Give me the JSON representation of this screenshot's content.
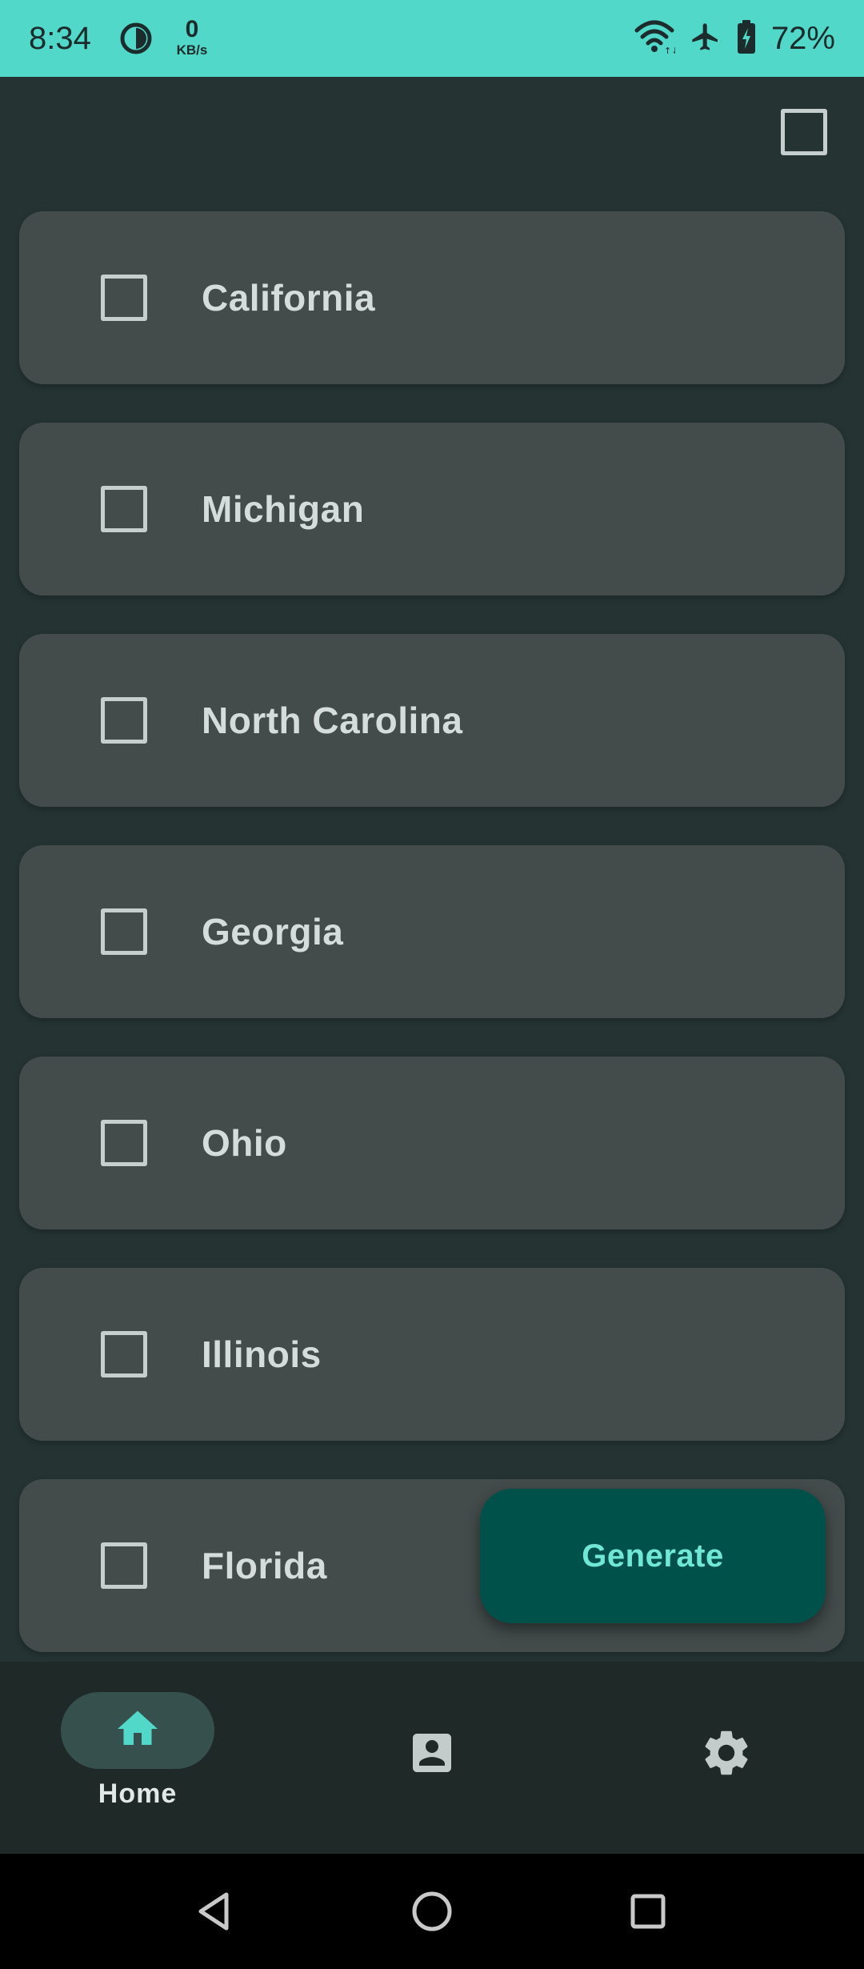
{
  "status_bar": {
    "time": "8:34",
    "net_speed_value": "0",
    "net_speed_unit": "KB/s",
    "battery_percent": "72%",
    "icons": [
      "data-saver-icon",
      "wifi-icon",
      "airplane-icon",
      "battery-charging-icon"
    ]
  },
  "list": {
    "items": [
      {
        "label": "California",
        "checked": false
      },
      {
        "label": "Michigan",
        "checked": false
      },
      {
        "label": "North Carolina",
        "checked": false
      },
      {
        "label": "Georgia",
        "checked": false
      },
      {
        "label": "Ohio",
        "checked": false
      },
      {
        "label": "Illinois",
        "checked": false
      },
      {
        "label": "Florida",
        "checked": false
      }
    ]
  },
  "fab": {
    "label": "Generate"
  },
  "bottom_nav": {
    "items": [
      {
        "label": "Home",
        "icon": "home-icon",
        "selected": true
      },
      {
        "label": "",
        "icon": "contact-icon",
        "selected": false
      },
      {
        "label": "",
        "icon": "settings-icon",
        "selected": false
      }
    ]
  },
  "system_nav": {
    "icons": [
      "back-icon",
      "home-circle-icon",
      "recents-icon"
    ]
  },
  "colors": {
    "status_bar": "#51d8c8",
    "background": "#253333",
    "card": "#434c4b",
    "fab_background": "#005149",
    "fab_text": "#6fe8d6",
    "nav_active_pill": "#35504d",
    "nav_active_icon": "#51d8c8"
  }
}
